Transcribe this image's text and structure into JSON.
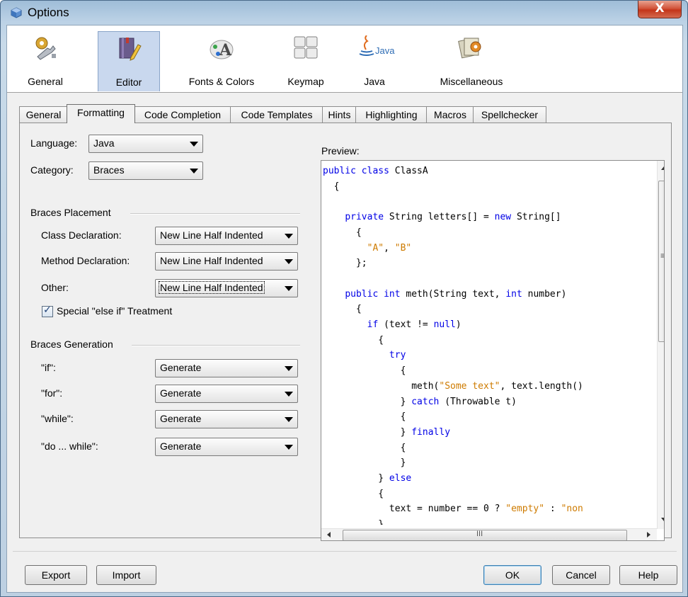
{
  "window": {
    "title": "Options",
    "close_glyph": "X"
  },
  "categories": [
    {
      "label": "General",
      "icon": "gear-wrench-icon",
      "selected": false
    },
    {
      "label": "Editor",
      "icon": "book-pencil-icon",
      "selected": true
    },
    {
      "label": "Fonts & Colors",
      "icon": "font-palette-icon",
      "selected": false
    },
    {
      "label": "Keymap",
      "icon": "keyboard-icon",
      "selected": false
    },
    {
      "label": "Java",
      "icon": "java-logo-icon",
      "selected": false,
      "logo_text": "Java"
    },
    {
      "label": "Miscellaneous",
      "icon": "photos-gear-icon",
      "selected": false
    }
  ],
  "tabs": [
    {
      "label": "General",
      "active": false
    },
    {
      "label": "Formatting",
      "active": true
    },
    {
      "label": "Code Completion",
      "active": false
    },
    {
      "label": "Code Templates",
      "active": false
    },
    {
      "label": "Hints",
      "active": false
    },
    {
      "label": "Highlighting",
      "active": false
    },
    {
      "label": "Macros",
      "active": false
    },
    {
      "label": "Spellchecker",
      "active": false
    }
  ],
  "formatting": {
    "language_label": "Language:",
    "language_value": "Java",
    "category_label": "Category:",
    "category_value": "Braces",
    "braces_placement": {
      "title": "Braces Placement",
      "class_label": "Class Declaration:",
      "class_value": "New Line Half Indented",
      "method_label": "Method Declaration:",
      "method_value": "New Line Half Indented",
      "other_label": "Other:",
      "other_value": "New Line Half Indented",
      "special_else_if_label": "Special \"else if\" Treatment",
      "special_else_if_checked": true
    },
    "braces_generation": {
      "title": "Braces Generation",
      "if_label": "\"if\":",
      "if_value": "Generate",
      "for_label": "\"for\":",
      "for_value": "Generate",
      "while_label": "\"while\":",
      "while_value": "Generate",
      "do_while_label": "\"do ... while\":",
      "do_while_value": "Generate"
    }
  },
  "preview": {
    "label": "Preview:",
    "lines": [
      [
        {
          "t": "public class",
          "c": "kw"
        },
        {
          "t": " ClassA"
        }
      ],
      [
        {
          "t": "  {"
        }
      ],
      [
        {
          "t": ""
        }
      ],
      [
        {
          "t": "    "
        },
        {
          "t": "private",
          "c": "kw"
        },
        {
          "t": " String letters[] = "
        },
        {
          "t": "new",
          "c": "kw"
        },
        {
          "t": " String[]"
        }
      ],
      [
        {
          "t": "      {"
        }
      ],
      [
        {
          "t": "        "
        },
        {
          "t": "\"A\"",
          "c": "str"
        },
        {
          "t": ", "
        },
        {
          "t": "\"B\"",
          "c": "str"
        }
      ],
      [
        {
          "t": "      };"
        }
      ],
      [
        {
          "t": ""
        }
      ],
      [
        {
          "t": "    "
        },
        {
          "t": "public int",
          "c": "kw"
        },
        {
          "t": " meth(String text, "
        },
        {
          "t": "int",
          "c": "kw"
        },
        {
          "t": " number)"
        }
      ],
      [
        {
          "t": "      {"
        }
      ],
      [
        {
          "t": "        "
        },
        {
          "t": "if",
          "c": "kw"
        },
        {
          "t": " (text != "
        },
        {
          "t": "null",
          "c": "kw"
        },
        {
          "t": ")"
        }
      ],
      [
        {
          "t": "          {"
        }
      ],
      [
        {
          "t": "            "
        },
        {
          "t": "try",
          "c": "kw"
        }
      ],
      [
        {
          "t": "              {"
        }
      ],
      [
        {
          "t": "                meth("
        },
        {
          "t": "\"Some text\"",
          "c": "str"
        },
        {
          "t": ", text.length()"
        }
      ],
      [
        {
          "t": "              } "
        },
        {
          "t": "catch",
          "c": "kw"
        },
        {
          "t": " (Throwable t)"
        }
      ],
      [
        {
          "t": "              {"
        }
      ],
      [
        {
          "t": "              } "
        },
        {
          "t": "finally",
          "c": "kw"
        }
      ],
      [
        {
          "t": "              {"
        }
      ],
      [
        {
          "t": "              }"
        }
      ],
      [
        {
          "t": "          } "
        },
        {
          "t": "else",
          "c": "kw"
        }
      ],
      [
        {
          "t": "          {"
        }
      ],
      [
        {
          "t": "            text = number == 0 ? "
        },
        {
          "t": "\"empty\"",
          "c": "str"
        },
        {
          "t": " : "
        },
        {
          "t": "\"non",
          "c": "str"
        }
      ],
      [
        {
          "t": "          }"
        }
      ]
    ],
    "hscroll_grip": "III",
    "vscroll_grip": "≡"
  },
  "buttons": {
    "export": "Export",
    "import": "Import",
    "ok": "OK",
    "cancel": "Cancel",
    "help": "Help"
  },
  "colors": {
    "keyword": "#0000e6",
    "string": "#ce7b00",
    "selected_category": "#c9d8ee"
  }
}
